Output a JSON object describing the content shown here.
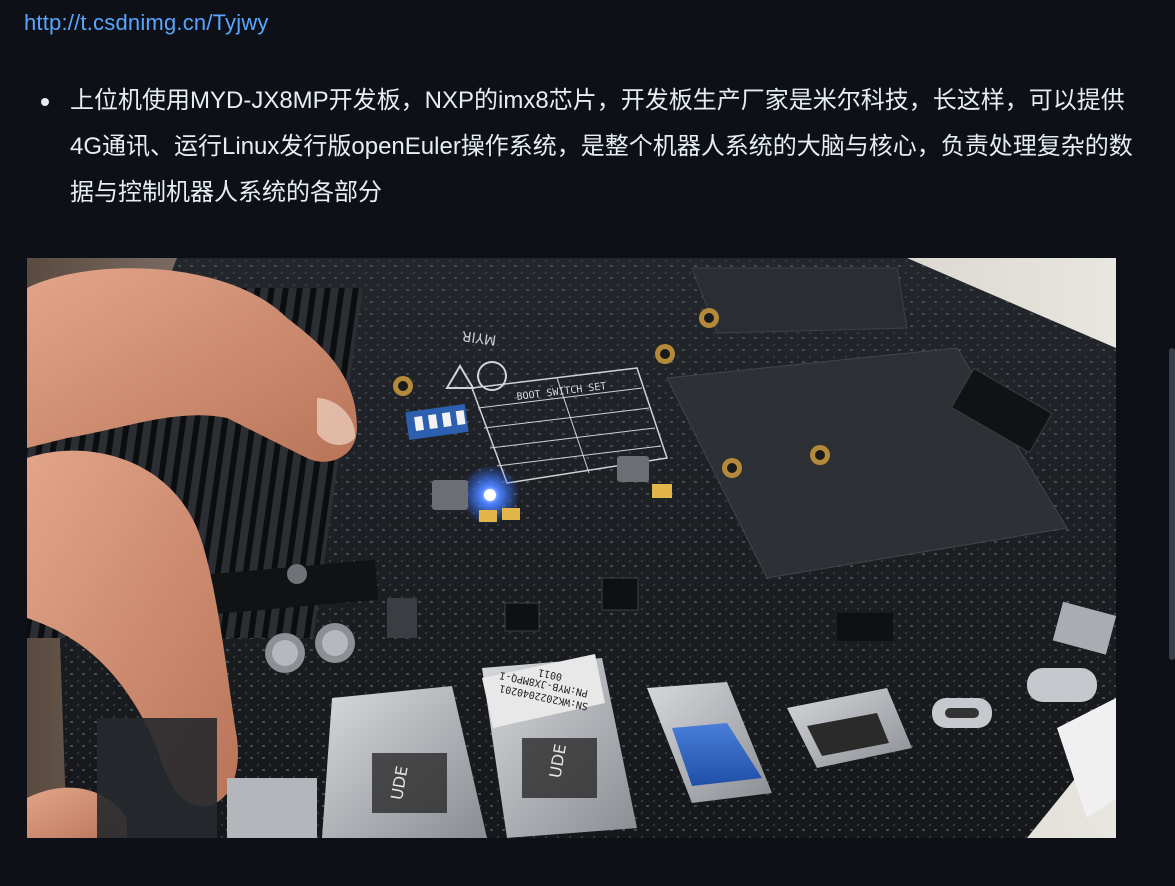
{
  "article": {
    "link_text": "http://t.csdnimg.cn/Tyjwy",
    "bullet_text": "上位机使用MYD-JX8MP开发板，NXP的imx8芯片，开发板生产厂家是米尔科技，长这样，可以提供4G通讯、运行Linux发行版openEuler操作系统，是整个机器人系统的大脑与核心，负责处理复杂的数据与控制机器人系统的各部分"
  },
  "photo": {
    "board_label": "PN:MYB-JX8MPQ-I",
    "board_sn": "SN:WK2022040201",
    "board_code": "0011",
    "brand_mark": "MYIR",
    "table_header": "BOOT SWITCH SET",
    "port_text_1": "UDE",
    "port_text_2": "UDE",
    "led_color": "#2f6bff"
  },
  "colors": {
    "background": "#0d1117",
    "link": "#58a6ff",
    "text": "#e6edf3"
  }
}
